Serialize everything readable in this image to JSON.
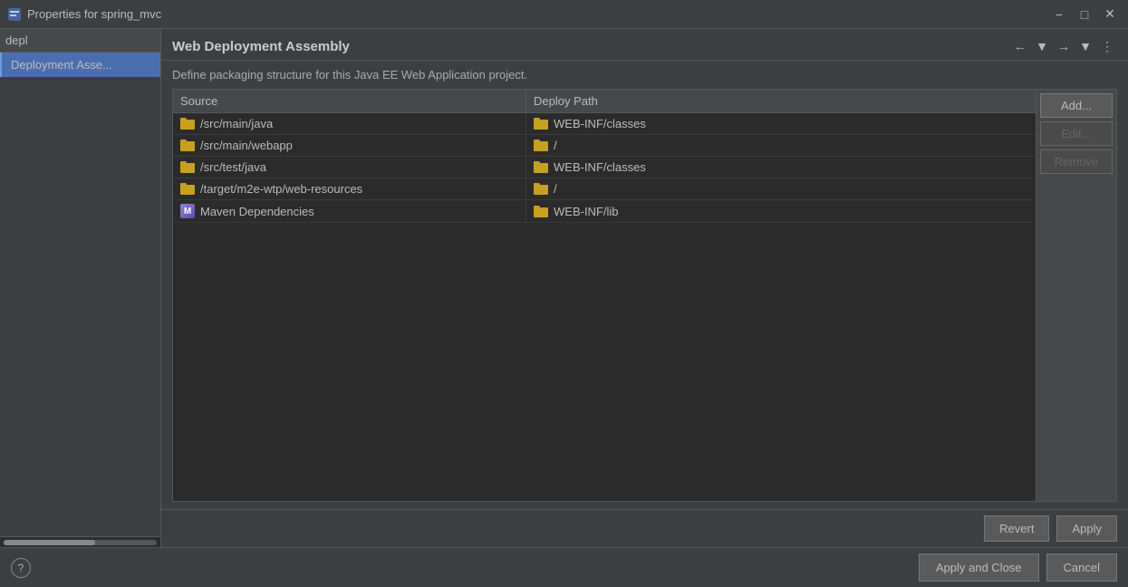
{
  "titleBar": {
    "title": "Properties for spring_mvc",
    "minimizeLabel": "−",
    "maximizeLabel": "□",
    "closeLabel": "✕"
  },
  "sidebar": {
    "searchValue": "depl",
    "item": "Deployment Asse..."
  },
  "panel": {
    "title": "Web Deployment Assembly",
    "description": "Define packaging structure for this Java EE Web Application project.",
    "upArrowLabel": "▲",
    "backLabel": "←",
    "forwardLabel": "→",
    "dropdownLabel": "▼",
    "moreLabel": "⋮"
  },
  "table": {
    "sourceHeader": "Source",
    "deployHeader": "Deploy Path",
    "rows": [
      {
        "source": "/src/main/java",
        "deployPath": "WEB-INF/classes"
      },
      {
        "source": "/src/main/webapp",
        "deployPath": "/"
      },
      {
        "source": "/src/test/java",
        "deployPath": "WEB-INF/classes"
      },
      {
        "source": "/target/m2e-wtp/web-resources",
        "deployPath": "/"
      },
      {
        "source": "Maven Dependencies",
        "deployPath": "WEB-INF/lib",
        "isMaven": true
      }
    ]
  },
  "sideButtons": {
    "add": "Add...",
    "edit": "Edit...",
    "remove": "Remove"
  },
  "bottomButtons": {
    "revert": "Revert",
    "apply": "Apply"
  },
  "footer": {
    "helpLabel": "?",
    "applyAndClose": "Apply and Close",
    "cancel": "Cancel"
  }
}
